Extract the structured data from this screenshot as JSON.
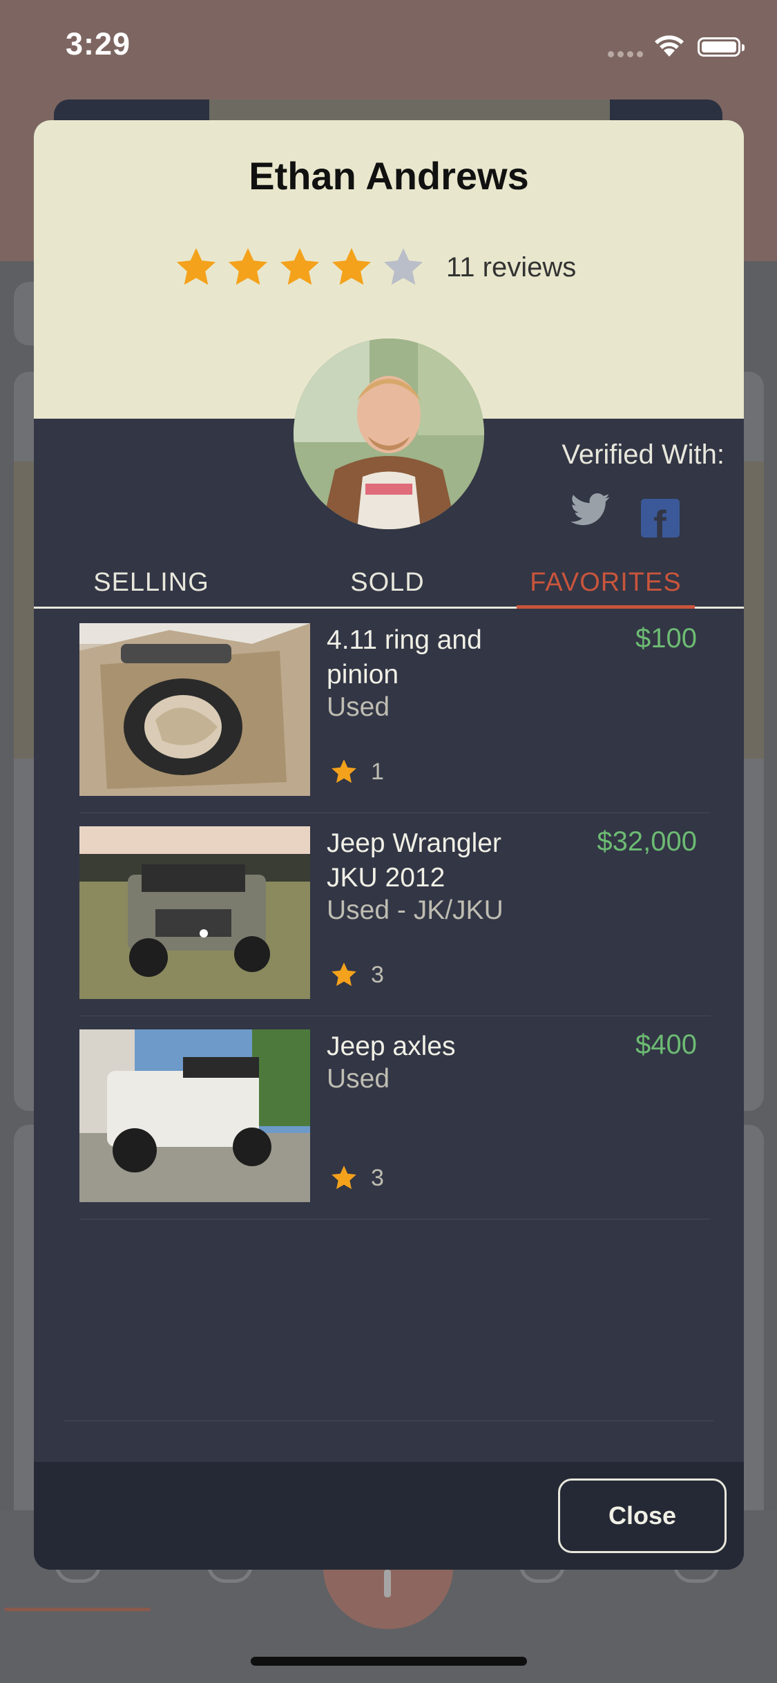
{
  "status_bar": {
    "time": "3:29"
  },
  "profile": {
    "name": "Ethan Andrews",
    "rating": 4,
    "rating_max": 5,
    "reviews": "11 reviews",
    "verified_label": "Verified With:",
    "verified_icons": [
      "twitter-icon",
      "facebook-icon"
    ]
  },
  "tabs": [
    {
      "label": "SELLING",
      "active": false
    },
    {
      "label": "SOLD",
      "active": false
    },
    {
      "label": "FAVORITES",
      "active": true
    }
  ],
  "listings": [
    {
      "title": "4.11 ring and pinion",
      "condition": "Used",
      "price": "$100",
      "favorites": "1"
    },
    {
      "title": "Jeep Wrangler JKU 2012",
      "condition": "Used - JK/JKU",
      "price": "$32,000",
      "favorites": "3"
    },
    {
      "title": "Jeep axles",
      "condition": "Used",
      "price": "$400",
      "favorites": "3"
    }
  ],
  "footer": {
    "close_label": "Close"
  },
  "colors": {
    "header_bg": "#e8e7cd",
    "modal_bg": "#323645",
    "accent": "#c9553c",
    "price": "#6dbb73",
    "star": "#f4a21c",
    "star_empty": "#b9bec8"
  }
}
